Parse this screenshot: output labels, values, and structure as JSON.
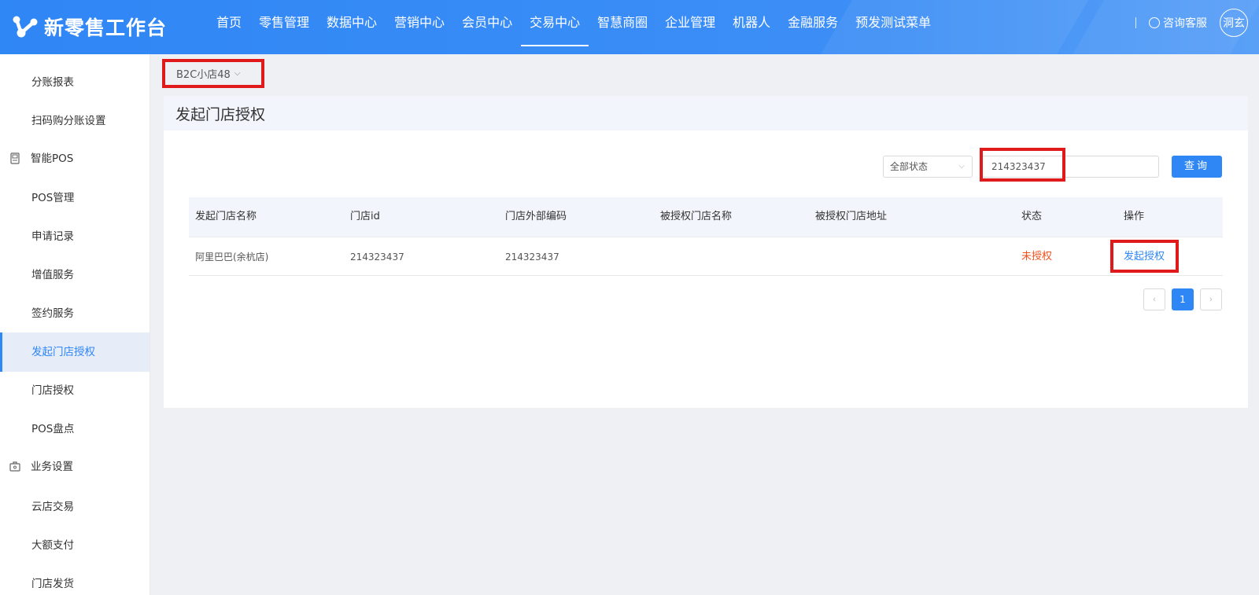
{
  "header": {
    "app_title": "新零售工作台",
    "nav": [
      "首页",
      "零售管理",
      "数据中心",
      "营销中心",
      "会员中心",
      "交易中心",
      "智慧商圈",
      "企业管理",
      "机器人",
      "金融服务",
      "预发测试菜单"
    ],
    "active_nav": "交易中心",
    "customer_service": "咨询客服",
    "avatar_text": "洞玄"
  },
  "sidebar": {
    "items": [
      {
        "label": "分账报表"
      },
      {
        "label": "扫码购分账设置"
      },
      {
        "label": "智能POS",
        "icon": "pos-device-icon"
      },
      {
        "label": "POS管理"
      },
      {
        "label": "申请记录"
      },
      {
        "label": "增值服务"
      },
      {
        "label": "签约服务"
      },
      {
        "label": "发起门店授权",
        "active": true
      },
      {
        "label": "门店授权"
      },
      {
        "label": "POS盘点"
      },
      {
        "label": "业务设置",
        "icon": "business-settings-icon"
      },
      {
        "label": "云店交易"
      },
      {
        "label": "大额支付"
      },
      {
        "label": "门店发货"
      }
    ]
  },
  "store_selector": {
    "value": "B2C小店48"
  },
  "page": {
    "title": "发起门店授权"
  },
  "filters": {
    "status_select": "全部状态",
    "search_value": "214323437",
    "query_button": "查询"
  },
  "table": {
    "headers": [
      "发起门店名称",
      "门店id",
      "门店外部编码",
      "被授权门店名称",
      "被授权门店地址",
      "状态",
      "操作"
    ],
    "rows": [
      {
        "name": "阿里巴巴(余杭店)",
        "store_id": "214323437",
        "external_code": "214323437",
        "authorized_name": "",
        "authorized_address": "",
        "status": "未授权",
        "action": "发起授权"
      }
    ]
  },
  "pagination": {
    "current_page": "1",
    "prev": "‹",
    "next": "›"
  },
  "colors": {
    "accent": "#2f86f5",
    "highlight": "#e01a1a",
    "status_unauthorized": "#f0521e"
  }
}
